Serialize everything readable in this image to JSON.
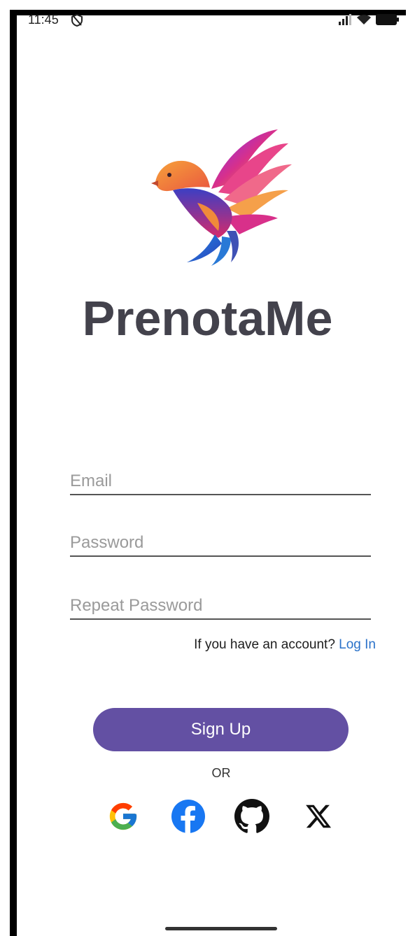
{
  "status_bar": {
    "time": "11:45",
    "left_icon": "shield-slash-icon",
    "signal_icon": "signal-icon",
    "wifi_icon": "wifi-icon",
    "battery_icon": "battery-icon"
  },
  "app": {
    "logo_icon": "bird-logo-icon",
    "title": "PrenotaMe"
  },
  "form": {
    "email_placeholder": "Email",
    "email_value": "",
    "password_placeholder": "Password",
    "password_value": "",
    "repeat_password_placeholder": "Repeat Password",
    "repeat_password_value": ""
  },
  "account_prompt": {
    "text": "If you have an account?",
    "link": "Log In"
  },
  "signup_button": "Sign Up",
  "or_text": "OR",
  "social": [
    {
      "name": "google",
      "icon": "google-icon"
    },
    {
      "name": "facebook",
      "icon": "facebook-icon"
    },
    {
      "name": "github",
      "icon": "github-icon"
    },
    {
      "name": "x",
      "icon": "x-icon"
    }
  ],
  "colors": {
    "primary": "#6350a3",
    "link": "#2a72c9",
    "title": "#43424c"
  }
}
